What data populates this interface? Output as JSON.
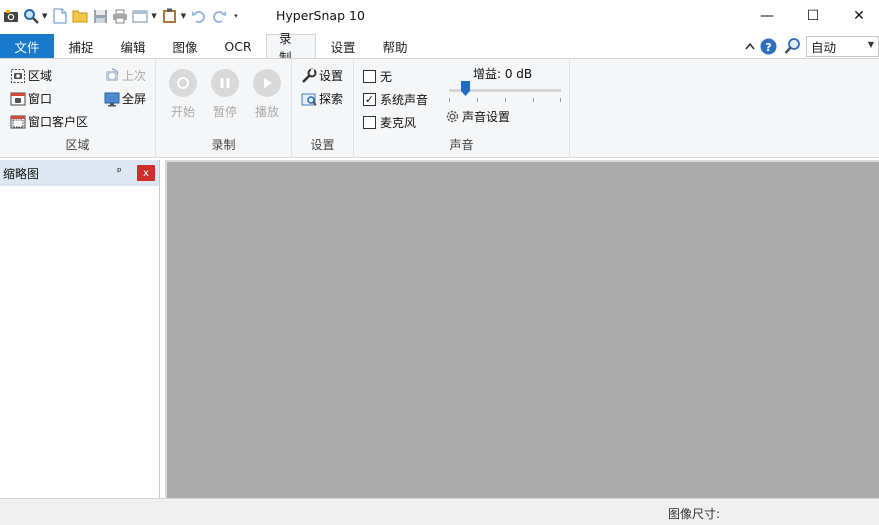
{
  "app": {
    "title": "HyperSnap 10"
  },
  "quick_access": {
    "icons": [
      "camera-icon",
      "zoom-icon",
      "new-doc-icon",
      "open-folder-icon",
      "save-icon",
      "print-icon",
      "window-icon",
      "clipboard-icon",
      "undo-icon",
      "redo-icon",
      "customize-arrow-icon"
    ]
  },
  "window_controls": {
    "minimize": "—",
    "maximize": "☐",
    "close": "✕"
  },
  "menu": {
    "file": "文件",
    "tabs": [
      "捕捉",
      "编辑",
      "图像",
      "OCR",
      "录制",
      "设置",
      "帮助"
    ],
    "active_tab": "录制"
  },
  "zoom_select": {
    "value": "自动"
  },
  "ribbon": {
    "region_group": {
      "label": "区域",
      "buttons": [
        "区域",
        "窗口",
        "窗口客户区",
        "上次",
        "全屏"
      ]
    },
    "record_group": {
      "label": "录制",
      "buttons": [
        "开始",
        "暂停",
        "播放"
      ]
    },
    "settings_group": {
      "label": "设置",
      "buttons": [
        "设置",
        "探索"
      ]
    },
    "sound_group": {
      "label": "声音",
      "options": [
        {
          "label": "无",
          "checked": false
        },
        {
          "label": "系统声音",
          "checked": true
        },
        {
          "label": "麦克风",
          "checked": false
        }
      ],
      "gain_label": "增益: 0 dB",
      "gain_value": 0.15,
      "sound_settings": "声音设置"
    }
  },
  "thumbnail_panel": {
    "title": "缩略图",
    "pin": "ᵖ",
    "close": "x"
  },
  "status": {
    "image_size_label": "图像尺寸:"
  },
  "colors": {
    "file_tab": "#1979ca",
    "canvas": "#ababab",
    "ribbon_bg": "#f5f6f7",
    "panel_head": "#dde7f2",
    "accent_blue": "#1e6fc4"
  }
}
